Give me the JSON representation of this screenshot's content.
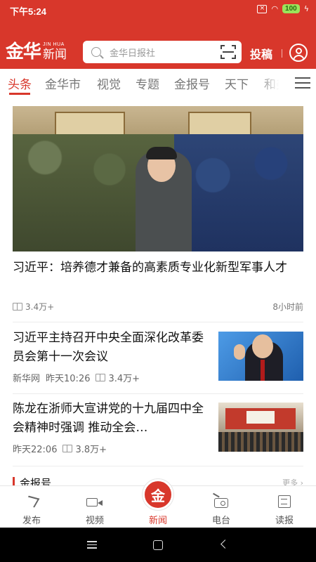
{
  "status": {
    "time": "下午5:24",
    "battery": "100"
  },
  "header": {
    "logo_main": "金华",
    "logo_en": "JIN HUA",
    "logo_cn": "新闻",
    "search_placeholder": "金华日报社",
    "submit_label": "投稿"
  },
  "tabs": [
    {
      "label": "头条",
      "active": true
    },
    {
      "label": "金华市"
    },
    {
      "label": "视觉"
    },
    {
      "label": "专题"
    },
    {
      "label": "金报号"
    },
    {
      "label": "天下"
    },
    {
      "label": "和美"
    }
  ],
  "featured": {
    "title": "习近平：培养德才兼备的高素质专业化新型军事人才",
    "views": "3.4万+",
    "time": "8小时前"
  },
  "news": [
    {
      "title": "习近平主持召开中央全面深化改革委员会第十一次会议",
      "source": "新华网",
      "time": "昨天10:26",
      "views": "3.4万+"
    },
    {
      "title": "陈龙在浙师大宣讲党的十九届四中全会精神时强调 推动全会…",
      "source": "",
      "time": "昨天22:06",
      "views": "3.8万+"
    }
  ],
  "section": {
    "label": "金报号",
    "more": "更多 ›"
  },
  "bottom_nav": [
    {
      "label": "发布",
      "icon": "send-icon"
    },
    {
      "label": "视频",
      "icon": "video-icon"
    },
    {
      "label": "新闻",
      "icon": "jinhua-logo-icon",
      "active": true
    },
    {
      "label": "电台",
      "icon": "radio-icon"
    },
    {
      "label": "读报",
      "icon": "newspaper-icon"
    }
  ],
  "center_logo": "金",
  "colors": {
    "brand_red": "#d8372b"
  }
}
